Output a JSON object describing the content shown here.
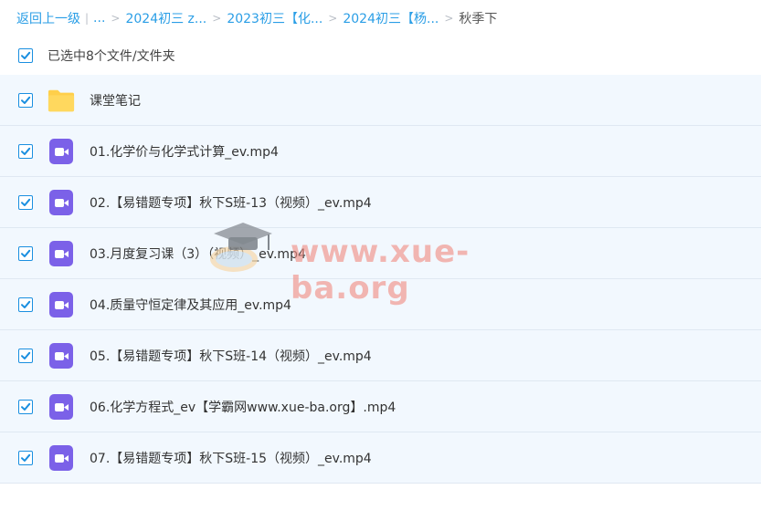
{
  "breadcrumb": {
    "back": "返回上一级",
    "ellipsis": "...",
    "separator": ">",
    "items": [
      "2024初三 z...",
      "2023初三【化...",
      "2024初三【杨..."
    ],
    "current": "秋季下"
  },
  "selection": {
    "text": "已选中8个文件/文件夹",
    "checked": true
  },
  "files": [
    {
      "name": "课堂笔记",
      "type": "folder-icon",
      "checked": true
    },
    {
      "name": "01.化学价与化学式计算_ev.mp4",
      "type": "video-icon",
      "checked": true
    },
    {
      "name": "02.【易错题专项】秋下S班-13（视频）_ev.mp4",
      "type": "video-icon",
      "checked": true
    },
    {
      "name": "03.月度复习课（3）（视频）_ev.mp4",
      "type": "video-icon",
      "checked": true
    },
    {
      "name": "04.质量守恒定律及其应用_ev.mp4",
      "type": "video-icon",
      "checked": true
    },
    {
      "name": "05.【易错题专项】秋下S班-14（视频）_ev.mp4",
      "type": "video-icon",
      "checked": true
    },
    {
      "name": "06.化学方程式_ev【学霸网www.xue-ba.org】.mp4",
      "type": "video-icon",
      "checked": true
    },
    {
      "name": "07.【易错题专项】秋下S班-15（视频）_ev.mp4",
      "type": "video-icon",
      "checked": true
    }
  ],
  "watermark": {
    "text": "www.xue-ba.org",
    "logo": "graduation-cap-icon"
  },
  "colors": {
    "accent": "#1a8fe0",
    "link": "#2a9ee6",
    "row_bg": "#f2f8fe",
    "folder": "#ffcf4a",
    "video": "#7b61e8"
  }
}
